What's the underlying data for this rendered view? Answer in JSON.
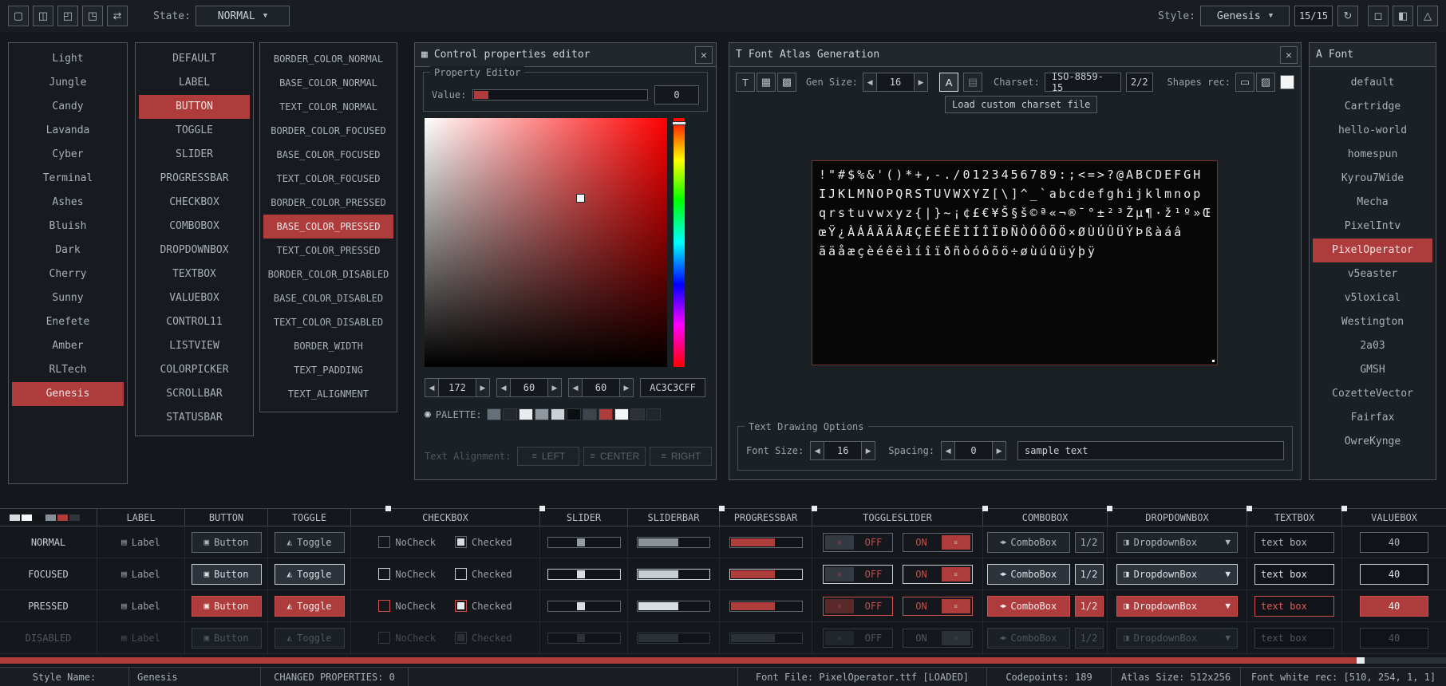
{
  "icons": {
    "chevron_down": "▼",
    "left": "◀",
    "right": "▶",
    "close": "×",
    "reload": "↻",
    "grid": "▦",
    "picker": "◉",
    "align": "≡",
    "letter_t": "T",
    "letter_a": "A",
    "table": "▤",
    "rect": "▭",
    "hatch": "▨"
  },
  "toolbar": {
    "left_buttons": [
      {
        "name": "new-file-button",
        "icon": "▢"
      },
      {
        "name": "open-file-button",
        "icon": "◫"
      },
      {
        "name": "save-file-button",
        "icon": "◰"
      },
      {
        "name": "export-file-button",
        "icon": "◳"
      },
      {
        "name": "random-style-button",
        "icon": "⇄"
      }
    ],
    "state_label": "State:",
    "state_value": "NORMAL",
    "style_label": "Style:",
    "style_value": "Genesis",
    "style_count": "15/15",
    "right_buttons": [
      {
        "name": "display-mode-button",
        "icon": "◻"
      },
      {
        "name": "window-mode-button",
        "icon": "◧"
      },
      {
        "name": "about-button",
        "icon": "△"
      }
    ]
  },
  "styles_list": {
    "items": [
      {
        "label": "Light"
      },
      {
        "label": "Jungle"
      },
      {
        "label": "Candy"
      },
      {
        "label": "Lavanda"
      },
      {
        "label": "Cyber"
      },
      {
        "label": "Terminal"
      },
      {
        "label": "Ashes"
      },
      {
        "label": "Bluish"
      },
      {
        "label": "Dark"
      },
      {
        "label": "Cherry"
      },
      {
        "label": "Sunny"
      },
      {
        "label": "Enefete"
      },
      {
        "label": "Amber"
      },
      {
        "label": "RLTech"
      },
      {
        "label": "Genesis",
        "selected": true
      }
    ]
  },
  "controls_list": {
    "items": [
      {
        "label": "DEFAULT"
      },
      {
        "label": "LABEL"
      },
      {
        "label": "BUTTON",
        "selected": true
      },
      {
        "label": "TOGGLE"
      },
      {
        "label": "SLIDER"
      },
      {
        "label": "PROGRESSBAR"
      },
      {
        "label": "CHECKBOX"
      },
      {
        "label": "COMBOBOX"
      },
      {
        "label": "DROPDOWNBOX"
      },
      {
        "label": "TEXTBOX"
      },
      {
        "label": "VALUEBOX"
      },
      {
        "label": "CONTROL11"
      },
      {
        "label": "LISTVIEW"
      },
      {
        "label": "COLORPICKER"
      },
      {
        "label": "SCROLLBAR"
      },
      {
        "label": "STATUSBAR"
      }
    ]
  },
  "properties_list": {
    "items": [
      {
        "label": "BORDER_COLOR_NORMAL"
      },
      {
        "label": "BASE_COLOR_NORMAL"
      },
      {
        "label": "TEXT_COLOR_NORMAL"
      },
      {
        "label": "BORDER_COLOR_FOCUSED"
      },
      {
        "label": "BASE_COLOR_FOCUSED"
      },
      {
        "label": "TEXT_COLOR_FOCUSED"
      },
      {
        "label": "BORDER_COLOR_PRESSED"
      },
      {
        "label": "BASE_COLOR_PRESSED",
        "selected": true
      },
      {
        "label": "TEXT_COLOR_PRESSED"
      },
      {
        "label": "BORDER_COLOR_DISABLED"
      },
      {
        "label": "BASE_COLOR_DISABLED"
      },
      {
        "label": "TEXT_COLOR_DISABLED"
      },
      {
        "label": "BORDER_WIDTH"
      },
      {
        "label": "TEXT_PADDING"
      },
      {
        "label": "TEXT_ALIGNMENT"
      }
    ]
  },
  "prop_editor": {
    "title": "Control properties editor",
    "group_label": "Property Editor",
    "value_label": "Value:",
    "value": "0",
    "rgb": [
      "172",
      "60",
      "60"
    ],
    "hex": "AC3C3CFF",
    "palette_label": "PALETTE:",
    "palette": [
      "#66707A",
      "#23282E",
      "#E9EBED",
      "#8F979F",
      "#CDD2D6",
      "#0C0F12",
      "#3C444C",
      "#AE3C3C",
      "#F4F5F6",
      "#2B3137",
      "#22272D"
    ],
    "text_alignment_label": "Text Alignment:",
    "align_buttons": [
      {
        "name": "align-left-button",
        "label": "LEFT"
      },
      {
        "name": "align-center-button",
        "label": "CENTER"
      },
      {
        "name": "align-right-button",
        "label": "RIGHT"
      }
    ]
  },
  "atlas": {
    "title": "Font Atlas Generation",
    "tool_buttons": [
      {
        "name": "text-editor-button",
        "icon": "T"
      },
      {
        "name": "atlas-grid-button",
        "icon": "▦"
      },
      {
        "name": "atlas-fill-button",
        "icon": "▩"
      }
    ],
    "gen_size_label": "Gen Size:",
    "gen_size": "16",
    "charset_label": "Charset:",
    "charset_value": "ISO-8859-15",
    "charset_count": "2/2",
    "shapes_label": "Shapes rec:",
    "shapes_buttons": [
      {
        "name": "shapes-rec-toggle",
        "icon": "▭"
      },
      {
        "name": "shapes-snap-toggle",
        "icon": "▨"
      }
    ],
    "tooltip": "Load custom charset file",
    "rows": [
      "!\"#$%&'()*+,-./0123456789:;<=>?@ABCDEFGH",
      "IJKLMNOPQRSTUVWXYZ[\\]^_`abcdefghijklmnop",
      "qrstuvwxyz{|}~¡¢£€¥Š§š©ª«¬®¯°±²³Žµ¶·ž¹º»Œ",
      "œŸ¿ÀÁÂÃÄÅÆÇÈÉÊËÌÍÎÏÐÑÒÓÔÕÖ×ØÙÚÛÜÝÞßàáâ",
      "ãäåæçèéêëìíîïðñòóôõö÷øùúûüýþÿ"
    ],
    "text_options_label": "Text Drawing Options",
    "font_size_label": "Font Size:",
    "font_size": "16",
    "spacing_label": "Spacing:",
    "spacing": "0",
    "sample_text": "sample text"
  },
  "font_list": {
    "title": "Font",
    "items": [
      {
        "label": "default"
      },
      {
        "label": "Cartridge"
      },
      {
        "label": "hello-world"
      },
      {
        "label": "homespun"
      },
      {
        "label": "Kyrou7Wide"
      },
      {
        "label": "Mecha"
      },
      {
        "label": "PixelIntv"
      },
      {
        "label": "PixelOperator",
        "selected": true
      },
      {
        "label": "v5easter"
      },
      {
        "label": "v5loxical"
      },
      {
        "label": "Westington"
      },
      {
        "label": "2a03"
      },
      {
        "label": "GMSH"
      },
      {
        "label": "CozetteVector"
      },
      {
        "label": "Fairfax"
      },
      {
        "label": "OwreKynge"
      }
    ]
  },
  "sampler": {
    "states": [
      "NORMAL",
      "FOCUSED",
      "PRESSED",
      "DISABLED"
    ],
    "columns": [
      {
        "id": "label",
        "label": "LABEL"
      },
      {
        "id": "button",
        "label": "BUTTON"
      },
      {
        "id": "toggle",
        "label": "TOGGLE"
      },
      {
        "id": "checkbox",
        "label": "CHECKBOX"
      },
      {
        "id": "slider",
        "label": "SLIDER"
      },
      {
        "id": "sliderbar",
        "label": "SLIDERBAR"
      },
      {
        "id": "progressbar",
        "label": "PROGRESSBAR"
      },
      {
        "id": "toggleslider",
        "label": "TOGGLESLIDER"
      },
      {
        "id": "combobox",
        "label": "COMBOBOX"
      },
      {
        "id": "dropdownbox",
        "label": "DROPDOWNBOX"
      },
      {
        "id": "textbox",
        "label": "TEXTBOX"
      },
      {
        "id": "valuebox",
        "label": "VALUEBOX"
      }
    ],
    "texts": {
      "label": "Label",
      "button": "Button",
      "toggle": "Toggle",
      "nocheck": "NoCheck",
      "checked": "Checked",
      "off": "OFF",
      "on": "ON",
      "combobox": "ComboBox",
      "combo_count": "1/2",
      "dropdownbox": "DropdownBox",
      "textbox": "text box",
      "valuebox": "40"
    },
    "icons": {
      "label": "▤",
      "button": "▣",
      "toggle": "◭",
      "combobox": "◀▶",
      "dropdownbox": "◨",
      "arrow": "▼",
      "knob": "▫"
    },
    "mini_palette": [
      "#D9DCDF",
      "#F6F7F8",
      "#101316",
      "#86909A",
      "#AE3C3C",
      "#2E343A"
    ]
  },
  "statusbar": {
    "style_name_label": "Style Name:",
    "style_name": "Genesis",
    "changed_properties": "CHANGED PROPERTIES: 0",
    "font_file": "Font File: PixelOperator.ttf [LOADED]",
    "codepoints": "Codepoints: 189",
    "atlas_size": "Atlas Size: 512x256",
    "white_rec": "Font white rec: [510, 254, 1, 1]"
  }
}
